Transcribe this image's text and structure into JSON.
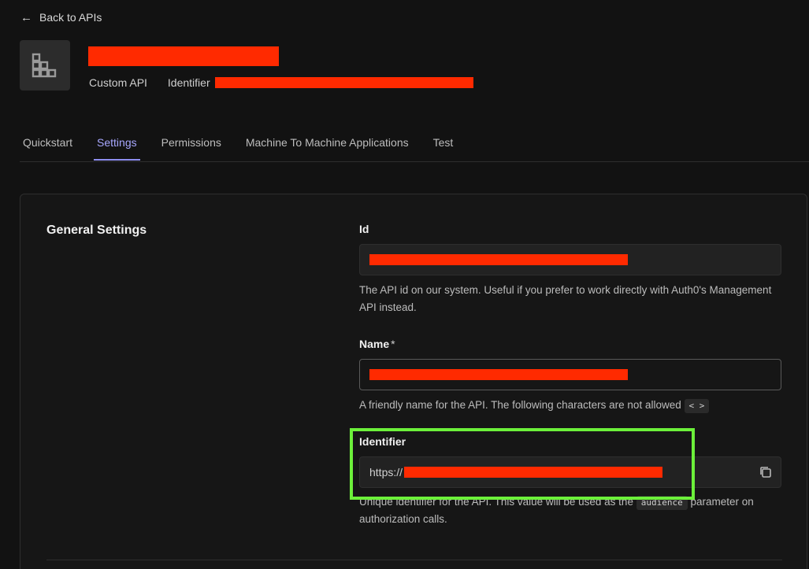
{
  "nav": {
    "back_label": "Back to APIs"
  },
  "header": {
    "api_type": "Custom API",
    "identifier_label": "Identifier"
  },
  "tabs": [
    {
      "label": "Quickstart",
      "active": false
    },
    {
      "label": "Settings",
      "active": true
    },
    {
      "label": "Permissions",
      "active": false
    },
    {
      "label": "Machine To Machine Applications",
      "active": false
    },
    {
      "label": "Test",
      "active": false
    }
  ],
  "general_settings": {
    "title": "General Settings",
    "id_field": {
      "label": "Id",
      "help": "The API id on our system. Useful if you prefer to work directly with Auth0's Management API instead."
    },
    "name_field": {
      "label": "Name",
      "required_mark": "*",
      "help": "A friendly name for the API. The following characters are not allowed",
      "disallowed": "< >"
    },
    "identifier_field": {
      "label": "Identifier",
      "value_prefix": "https://",
      "help_before": "Unique identifier for the API. This value will be used as the",
      "help_code": "audience",
      "help_after": "parameter on authorization calls."
    }
  },
  "colors": {
    "accent": "#8d8df0",
    "redaction": "#ff2a00",
    "highlight": "#6cf03a",
    "background": "#121212"
  },
  "icons": [
    "arrow-left-icon",
    "building-icon",
    "copy-icon"
  ]
}
